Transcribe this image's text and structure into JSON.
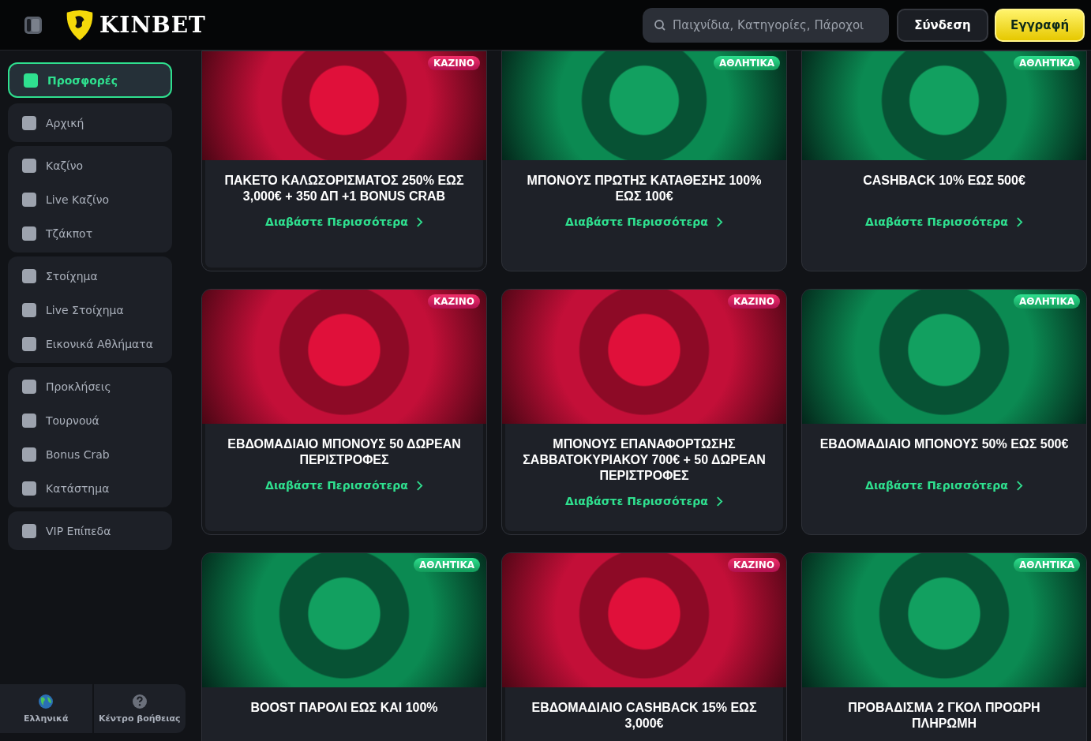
{
  "header": {
    "brand": "KINBET",
    "search": {
      "placeholder": "Παιχνίδια, Κατηγορίες, Πάροχοι"
    },
    "login": "Σύνδεση",
    "register": "Εγγραφή"
  },
  "sidebar": {
    "groups": [
      [
        {
          "label": "Προσφορές",
          "selected": true
        }
      ],
      [
        {
          "label": "Αρχική",
          "selected": false
        }
      ],
      [
        {
          "label": "Καζίνο",
          "selected": false
        },
        {
          "label": "Live Καζίνο",
          "selected": false
        },
        {
          "label": "Τζάκποτ",
          "selected": false
        }
      ],
      [
        {
          "label": "Στοίχημα",
          "selected": false
        },
        {
          "label": "Live Στοίχημα",
          "selected": false
        },
        {
          "label": "Εικονικά Αθλήματα",
          "selected": false
        }
      ],
      [
        {
          "label": "Προκλήσεις",
          "selected": false
        },
        {
          "label": "Τουρνουά",
          "selected": false
        },
        {
          "label": "Bonus Crab",
          "selected": false
        },
        {
          "label": "Κατάστημα",
          "selected": false
        }
      ],
      [
        {
          "label": "VIP Επίπεδα",
          "selected": false
        }
      ]
    ],
    "footer": {
      "language": "Ελληνικά",
      "help": "Κέντρο βοήθειας"
    }
  },
  "promos": [
    {
      "kind": "casino",
      "tag": "ΚΑΖΙΝΟ",
      "title": "ΠΑΚΕΤΟ ΚΑΛΩΣΟΡΙΣΜΑΤΟΣ 250% ΕΩΣ 3,000€ + 350 ΔΠ +1 BONUS CRAB",
      "link": "Διαβάστε Περισσότερα"
    },
    {
      "kind": "sports",
      "tag": "ΑΘΛΗΤΙΚΑ",
      "title": "ΜΠΟΝΟΥΣ ΠΡΩΤΗΣ ΚΑΤΑΘΕΣΗΣ 100% ΕΩΣ 100€",
      "link": "Διαβάστε Περισσότερα"
    },
    {
      "kind": "sports",
      "tag": "ΑΘΛΗΤΙΚΑ",
      "title": "CASHBACK 10% ΕΩΣ 500€",
      "link": "Διαβάστε Περισσότερα"
    },
    {
      "kind": "casino",
      "tag": "ΚΑΖΙΝΟ",
      "title": "ΕΒΔΟΜΑΔΙΑΙΟ ΜΠΟΝΟΥΣ 50 ΔΩΡΕΑΝ ΠΕΡΙΣΤΡΟΦΕΣ",
      "link": "Διαβάστε Περισσότερα"
    },
    {
      "kind": "casino",
      "tag": "ΚΑΖΙΝΟ",
      "title": "ΜΠΟΝΟΥΣ ΕΠΑΝΑΦΟΡΤΩΣΗΣ ΣΑΒΒΑΤΟΚΥΡΙΑΚΟΥ 700€ + 50 ΔΩΡΕΑΝ ΠΕΡΙΣΤΡΟΦΕΣ",
      "link": "Διαβάστε Περισσότερα"
    },
    {
      "kind": "sports",
      "tag": "ΑΘΛΗΤΙΚΑ",
      "title": "ΕΒΔΟΜΑΔΙΑΙΟ ΜΠΟΝΟΥΣ 50% ΕΩΣ 500€",
      "link": "Διαβάστε Περισσότερα"
    },
    {
      "kind": "sports",
      "tag": "ΑΘΛΗΤΙΚΑ",
      "title": "BOOST ΠΑΡΟΛΙ ΕΩΣ ΚΑΙ 100%"
    },
    {
      "kind": "casino",
      "tag": "ΚΑΖΙΝΟ",
      "title": "ΕΒΔΟΜΑΔΙΑΙΟ CASHBACK 15% ΕΩΣ 3,000€"
    },
    {
      "kind": "sports",
      "tag": "ΑΘΛΗΤΙΚΑ",
      "title": "ΠΡΟΒΑΔΙΣΜΑ 2 ΓΚΟΛ ΠΡΟΩΡΗ ΠΛΗΡΩΜΗ"
    }
  ]
}
